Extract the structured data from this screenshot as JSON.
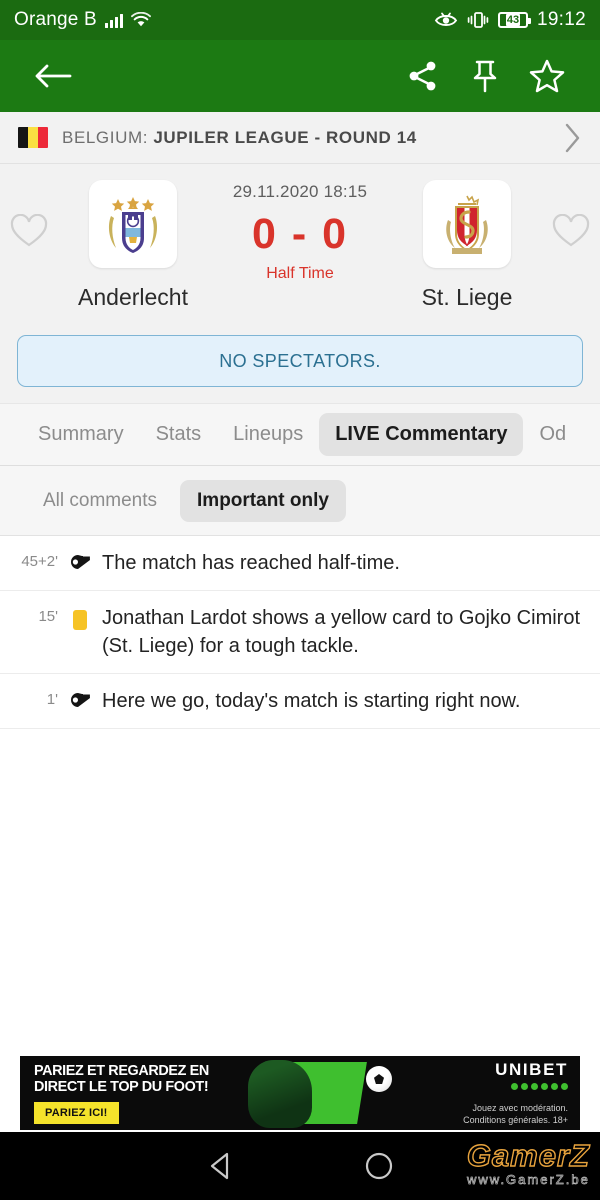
{
  "status_bar": {
    "carrier": "Orange B",
    "signal_icon": "signal-bars-icon",
    "wifi_icon": "wifi-icon",
    "eye_comfort_icon": "eye-icon",
    "vibrate_icon": "vibrate-icon",
    "battery_level": "43",
    "time": "19:12",
    "background_color": "#1B6B11"
  },
  "toolbar": {
    "back_icon": "back-arrow-icon",
    "share_icon": "share-icon",
    "pin_icon": "pin-icon",
    "star_icon": "star-icon",
    "background_color": "#1C7A13"
  },
  "league_header": {
    "flag": "belgium-flag-icon",
    "country": "BELGIUM: ",
    "competition": "JUPILER LEAGUE - ROUND 14",
    "chevron_icon": "chevron-right-icon"
  },
  "match": {
    "date_time": "29.11.2020 18:15",
    "score": "0 - 0",
    "stage": "Half Time",
    "score_color": "#D9342B",
    "home": {
      "name": "Anderlecht",
      "crest": "anderlecht-crest",
      "favorite_icon": "heart-outline-icon"
    },
    "away": {
      "name": "St. Liege",
      "crest": "standard-liege-crest",
      "favorite_icon": "heart-outline-icon"
    },
    "banner": "NO SPECTATORS.",
    "banner_text_color": "#2B7091",
    "banner_bg_color": "#E3F1FB"
  },
  "tabs": [
    {
      "label": "Summary",
      "active": false
    },
    {
      "label": "Stats",
      "active": false
    },
    {
      "label": "Lineups",
      "active": false
    },
    {
      "label": "LIVE Commentary",
      "active": true
    },
    {
      "label": "Od",
      "active": false
    }
  ],
  "subtabs": [
    {
      "label": "All comments",
      "active": false
    },
    {
      "label": "Important only",
      "active": true
    }
  ],
  "commentary": [
    {
      "minute": "45+2'",
      "icon": "whistle-icon",
      "text": "The match has reached half-time."
    },
    {
      "minute": "15'",
      "icon": "yellow-card-icon",
      "text": "Jonathan Lardot shows a yellow card to Gojko Cimirot (St. Liege) for a tough tackle."
    },
    {
      "minute": "1'",
      "icon": "whistle-icon",
      "text": "Here we go, today's match is starting right now."
    }
  ],
  "ad": {
    "headline_line1": "PARIEZ ET REGARDEZ EN",
    "headline_line2": "DIRECT LE TOP DU FOOT!",
    "cta": "PARIEZ ICI!",
    "brand": "UNIBET",
    "disclaimer_line1": "Jouez avec modération.",
    "disclaimer_line2": "Conditions générales. 18+"
  },
  "navbar": {
    "back_icon": "nav-back-icon",
    "home_icon": "nav-home-icon",
    "watermark_main": "GamerZ",
    "watermark_sub": "www.GamerZ.be"
  }
}
